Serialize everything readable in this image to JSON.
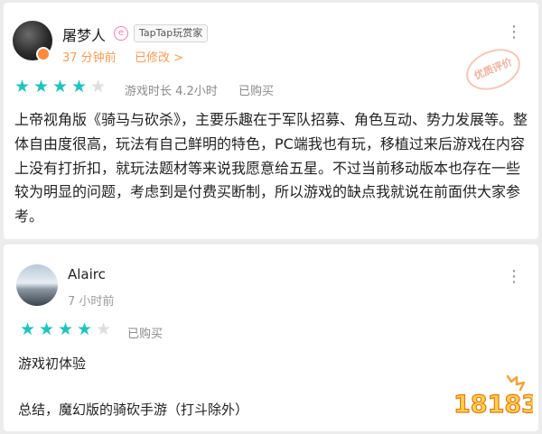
{
  "reviews": [
    {
      "user": "屠梦人",
      "level_icon": "e",
      "tag": "TapTap玩赏家",
      "time": "37 分钟前",
      "edited": "已修改 >",
      "stamp": "优质评价",
      "rating": 4,
      "max_rating": 5,
      "playtime": "游戏时长 4.2小时",
      "bought": "已购买",
      "text": "上帝视角版《骑马与砍杀》，主要乐趣在于军队招募、角色互动、势力发展等。整体自由度很高，玩法有自己鲜明的特色，PC端我也有玩，移植过来后游戏在内容上没有打折扣，就玩法题材等来说我愿意给五星。不过当前移动版本也存在一些较为明显的问题，考虑到是付费买断制，所以游戏的缺点我就说在前面供大家参考。"
    },
    {
      "user": "Alairc",
      "time": "7 小时前",
      "rating": 4,
      "max_rating": 5,
      "bought": "已购买",
      "text_line1": "游戏初体验",
      "text_line2": "总结，魔幻版的骑砍手游（打斗除外）"
    }
  ],
  "watermark": "18183",
  "colors": {
    "star_on": "#20c3bd",
    "star_off": "#dedede",
    "accent": "#ff9a55"
  },
  "icons": {
    "more": "more-vertical-icon",
    "star": "star-icon"
  }
}
